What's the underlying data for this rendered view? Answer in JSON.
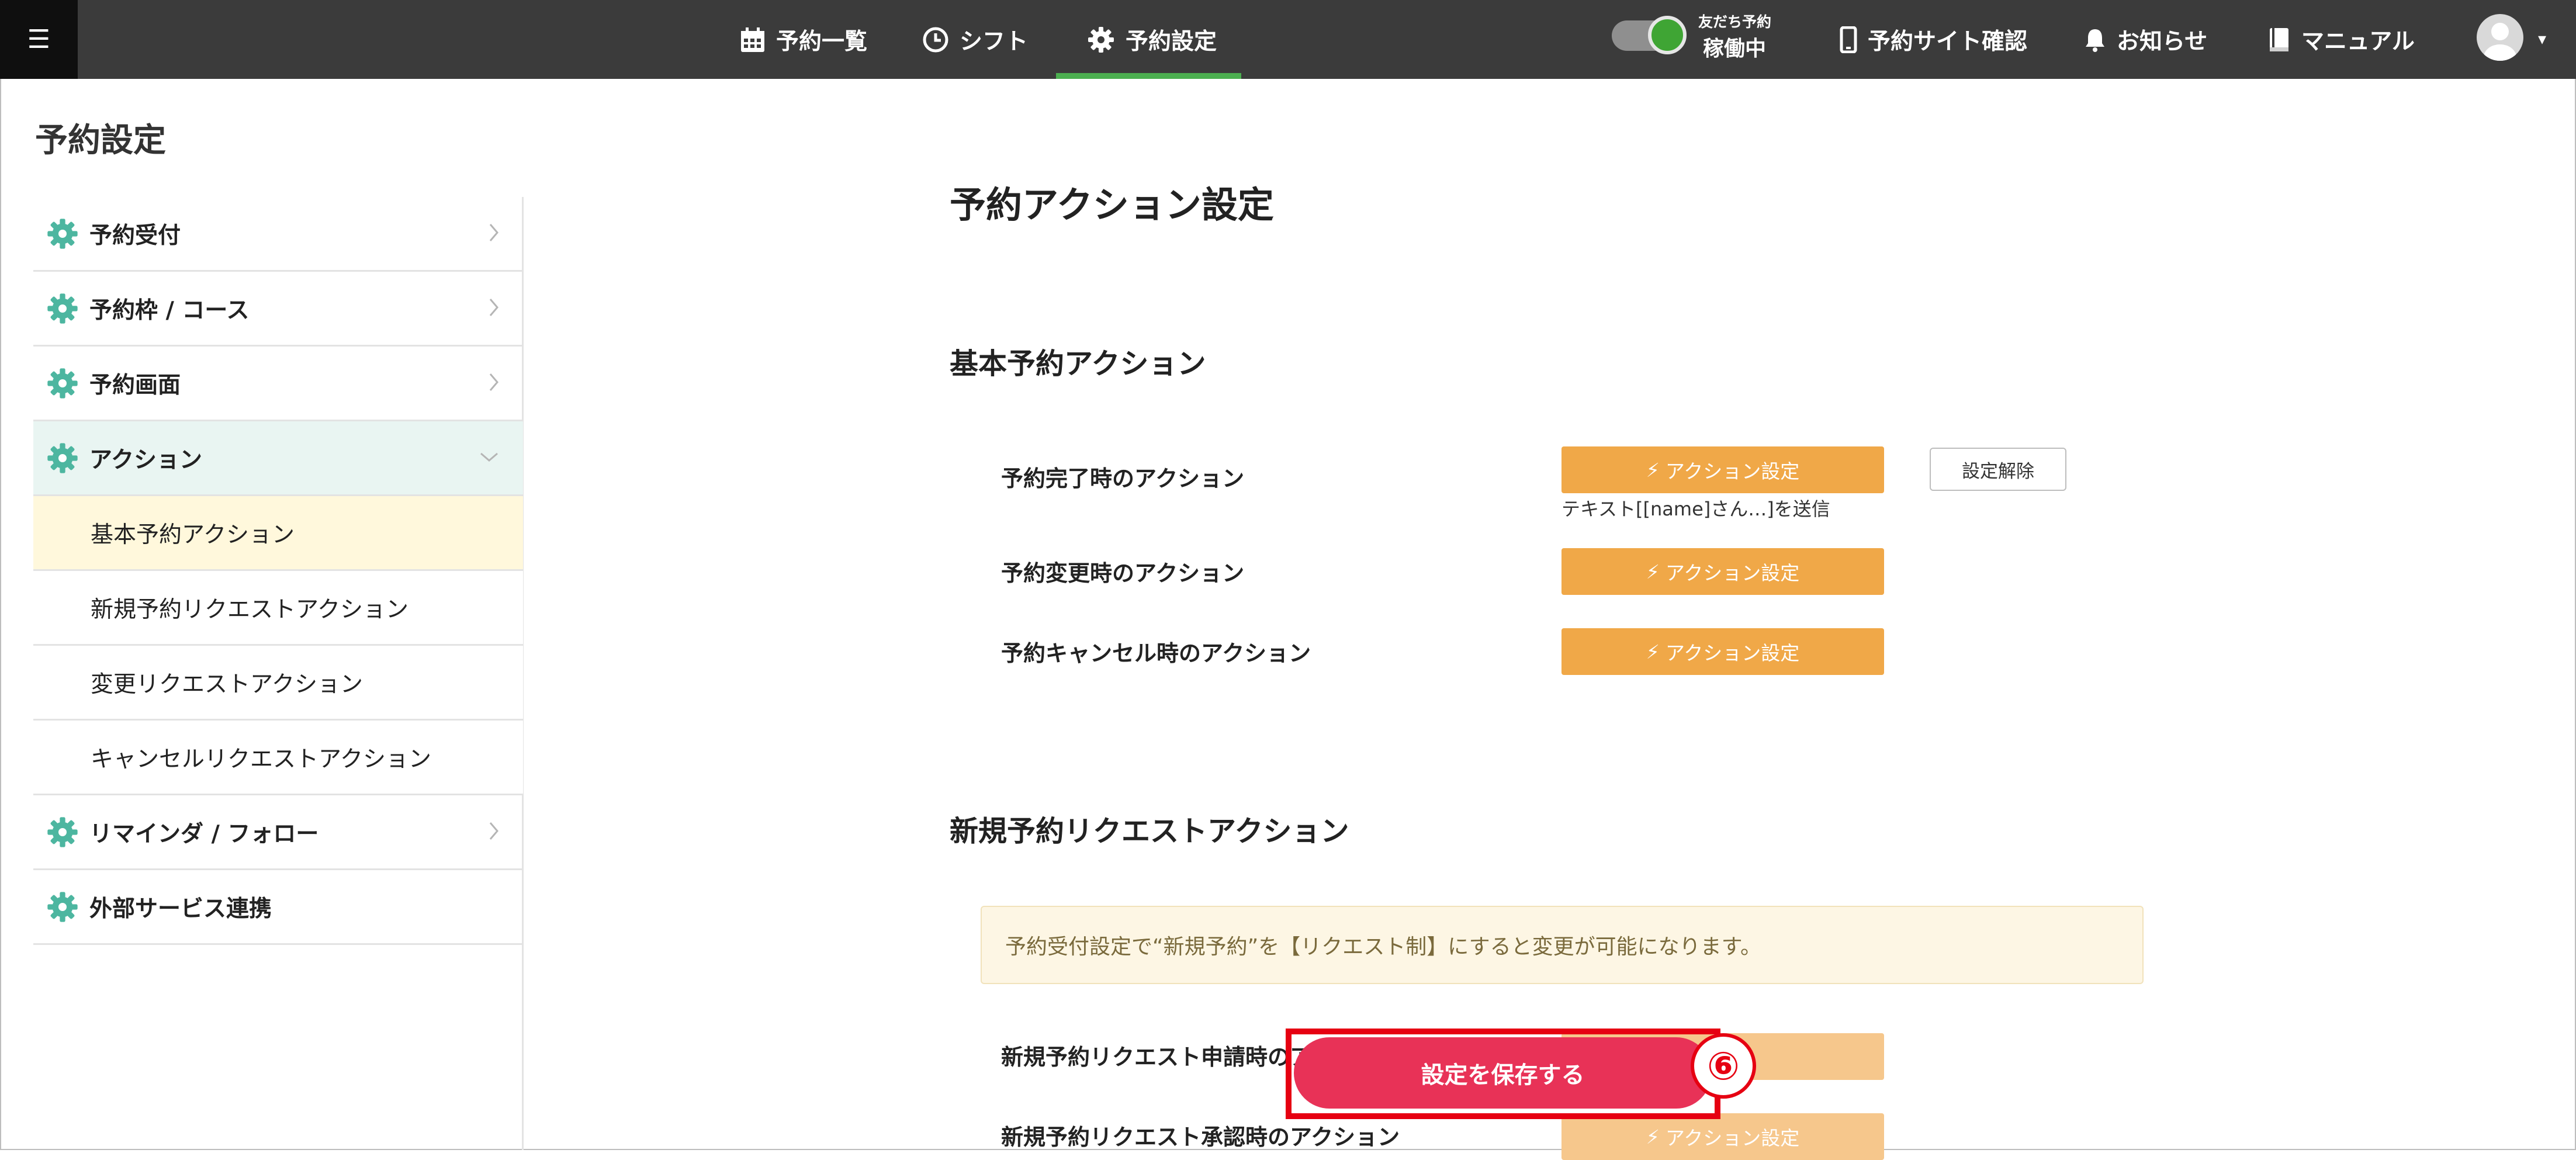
{
  "topbar": {
    "menu_icon": "hamburger-icon",
    "nav": [
      {
        "label": "予約一覧",
        "icon": "calendar-icon"
      },
      {
        "label": "シフト",
        "icon": "clock-icon"
      },
      {
        "label": "予約設定",
        "icon": "gear-icon",
        "active": true
      }
    ],
    "toggle_label_small": "友だち予約",
    "toggle_label_big": "稼働中",
    "site_check_label": "予約サイト確認",
    "notice_label": "お知らせ",
    "manual_label": "マニュアル",
    "user_menu_caret": "▾",
    "accent_active": "#4caf50",
    "toggle_on": true
  },
  "page": {
    "title": "予約設定"
  },
  "sidebar": {
    "items": [
      {
        "label": "予約受付",
        "has_gear": true,
        "chevron": "right"
      },
      {
        "label": "予約枠 / コース",
        "has_gear": true,
        "chevron": "right"
      },
      {
        "label": "予約画面",
        "has_gear": true,
        "chevron": "right"
      },
      {
        "label": "アクション",
        "has_gear": true,
        "chevron": "down",
        "active": true
      },
      {
        "label": "基本予約アクション",
        "sub": true,
        "selected": true
      },
      {
        "label": "新規予約リクエストアクション",
        "sub": true
      },
      {
        "label": "変更リクエストアクション",
        "sub": true
      },
      {
        "label": "キャンセルリクエストアクション",
        "sub": true
      },
      {
        "label": "リマインダ / フォロー",
        "has_gear": true,
        "chevron": "right"
      },
      {
        "label": "外部サービス連携",
        "has_gear": true
      }
    ],
    "gear_color": "#4db6a0"
  },
  "main": {
    "title": "予約アクション設定",
    "basic_section": {
      "title": "基本予約アクション",
      "rows": [
        {
          "label": "予約完了時のアクション",
          "button": "アクション設定",
          "clear": "設定解除",
          "desc": "テキスト[[name]さん…]を送信"
        },
        {
          "label": "予約変更時のアクション",
          "button": "アクション設定"
        },
        {
          "label": "予約キャンセル時のアクション",
          "button": "アクション設定"
        }
      ]
    },
    "request_section": {
      "title": "新規予約リクエストアクション",
      "notice": "予約受付設定で“新規予約”を【リクエスト制】にすると変更が可能になります。",
      "rows": [
        {
          "label": "新規予約リクエスト申請時のアクション"
        },
        {
          "label": "新規予約リクエスト承認時のアクション",
          "button": "アクション設定"
        }
      ]
    },
    "button_color": "#f0a848"
  },
  "save": {
    "label": "設定を保存する",
    "step_marker": "⑥",
    "color": "#e83257",
    "highlight_color": "#e60012"
  }
}
